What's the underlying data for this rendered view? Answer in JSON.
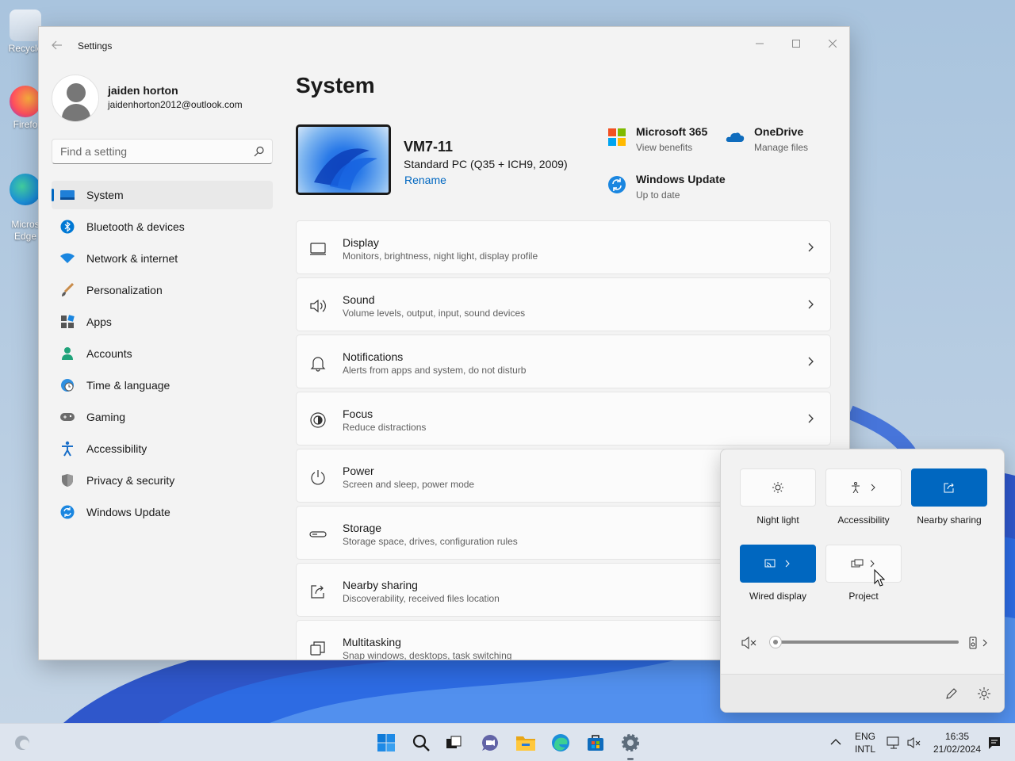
{
  "desktop": {
    "icons": [
      {
        "label": "Recycle"
      },
      {
        "label": "Firefo"
      },
      {
        "label": "Micros\nEdge"
      }
    ]
  },
  "window": {
    "title": "Settings",
    "back_icon": "back-arrow-icon",
    "controls": [
      "minimize-icon",
      "maximize-icon",
      "close-icon"
    ]
  },
  "profile": {
    "name": "jaiden horton",
    "email": "jaidenhorton2012@outlook.com"
  },
  "search": {
    "placeholder": "Find a setting"
  },
  "sidebar": {
    "items": [
      {
        "label": "System",
        "icon": "system-icon",
        "active": true
      },
      {
        "label": "Bluetooth & devices",
        "icon": "bluetooth-icon"
      },
      {
        "label": "Network & internet",
        "icon": "network-icon"
      },
      {
        "label": "Personalization",
        "icon": "brush-icon"
      },
      {
        "label": "Apps",
        "icon": "apps-icon"
      },
      {
        "label": "Accounts",
        "icon": "accounts-icon"
      },
      {
        "label": "Time & language",
        "icon": "globe-clock-icon"
      },
      {
        "label": "Gaming",
        "icon": "gamepad-icon"
      },
      {
        "label": "Accessibility",
        "icon": "accessibility-icon"
      },
      {
        "label": "Privacy & security",
        "icon": "shield-icon"
      },
      {
        "label": "Windows Update",
        "icon": "update-icon"
      }
    ]
  },
  "main": {
    "title": "System",
    "device": {
      "name": "VM7-11",
      "model": "Standard PC (Q35 + ICH9, 2009)",
      "rename": "Rename"
    },
    "quick_links": [
      {
        "title": "Microsoft 365",
        "subtitle": "View benefits",
        "icon": "microsoft-365-icon"
      },
      {
        "title": "OneDrive",
        "subtitle": "Manage files",
        "icon": "onedrive-icon"
      },
      {
        "title": "Windows Update",
        "subtitle": "Up to date",
        "icon": "windows-update-icon"
      }
    ],
    "cards": [
      {
        "title": "Display",
        "subtitle": "Monitors, brightness, night light, display profile",
        "icon": "display-icon"
      },
      {
        "title": "Sound",
        "subtitle": "Volume levels, output, input, sound devices",
        "icon": "speaker-icon"
      },
      {
        "title": "Notifications",
        "subtitle": "Alerts from apps and system, do not disturb",
        "icon": "bell-icon"
      },
      {
        "title": "Focus",
        "subtitle": "Reduce distractions",
        "icon": "focus-icon"
      },
      {
        "title": "Power",
        "subtitle": "Screen and sleep, power mode",
        "icon": "power-icon"
      },
      {
        "title": "Storage",
        "subtitle": "Storage space, drives, configuration rules",
        "icon": "storage-icon"
      },
      {
        "title": "Nearby sharing",
        "subtitle": "Discoverability, received files location",
        "icon": "share-icon"
      },
      {
        "title": "Multitasking",
        "subtitle": "Snap windows, desktops, task switching",
        "icon": "multitasking-icon"
      }
    ]
  },
  "quick_settings": {
    "tiles": [
      {
        "label": "Night light",
        "icon": "night-light-icon",
        "on": false
      },
      {
        "label": "Accessibility",
        "icon": "accessibility-icon",
        "on": false
      },
      {
        "label": "Nearby sharing",
        "icon": "nearby-sharing-icon",
        "on": true
      },
      {
        "label": "Wired display",
        "icon": "cast-icon",
        "on": true
      },
      {
        "label": "Project",
        "icon": "project-icon",
        "on": false
      }
    ],
    "volume": {
      "level": 0,
      "muted": true
    },
    "footer_icons": [
      "edit-icon",
      "settings-icon"
    ]
  },
  "taskbar": {
    "language_top": "ENG",
    "language_bottom": "INTL",
    "time": "16:35",
    "date": "21/02/2024",
    "accent": "#0067c0"
  }
}
